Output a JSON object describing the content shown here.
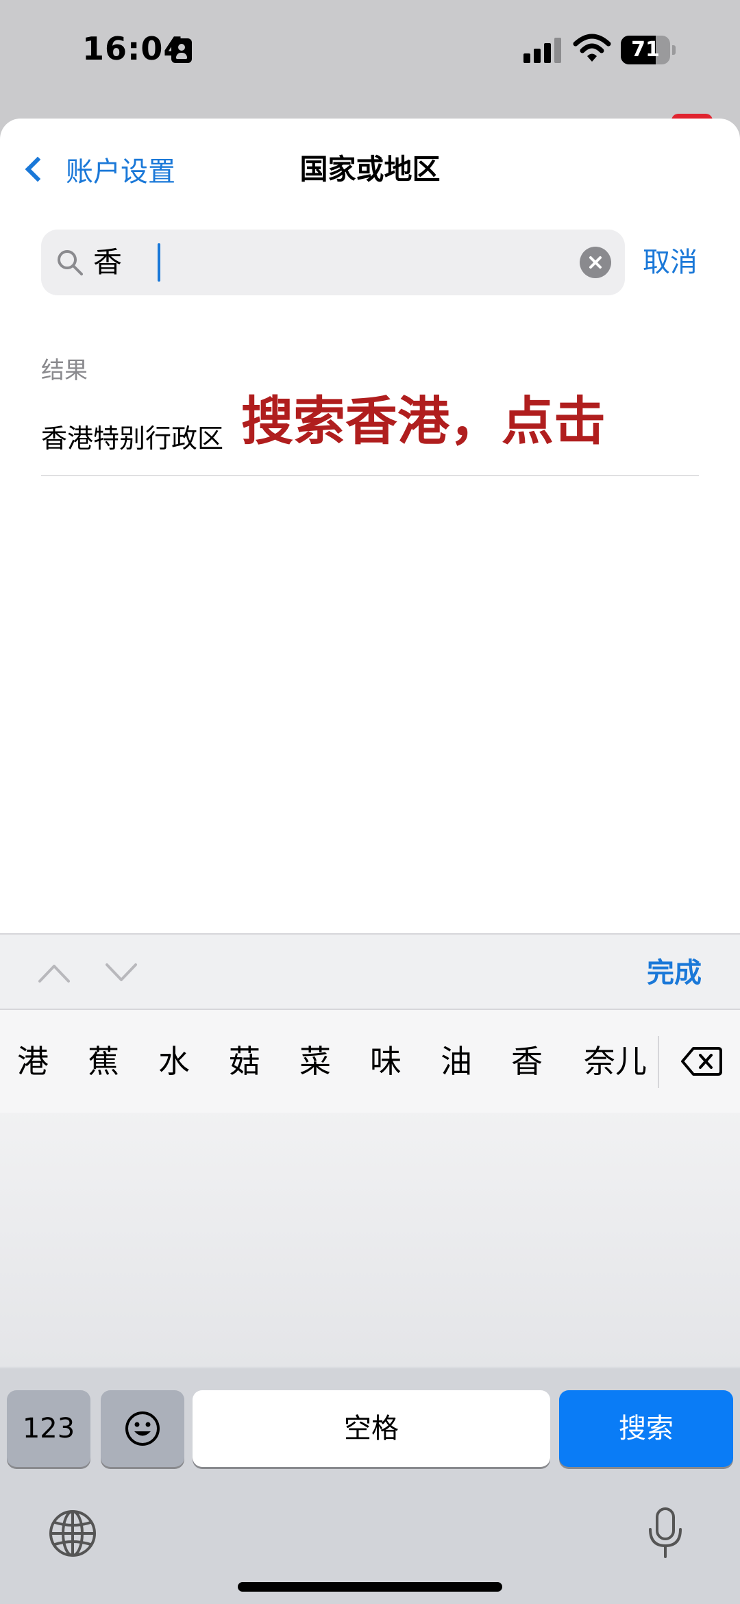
{
  "status_bar": {
    "time": "16:04",
    "battery": "71",
    "battery_level": 0.71
  },
  "nav": {
    "back_label": "账户设置",
    "title": "国家或地区"
  },
  "search": {
    "value": "香",
    "cancel_label": "取消"
  },
  "results": {
    "header": "结果",
    "items": [
      "香港特别行政区"
    ]
  },
  "annotation": "搜索香港，点击",
  "accessory": {
    "done_label": "完成"
  },
  "keyboard": {
    "candidates": [
      "港",
      "蕉",
      "水",
      "菇",
      "菜",
      "味",
      "油",
      "香",
      "奈儿"
    ],
    "numbers_label": "123",
    "space_label": "空格",
    "search_label": "搜索"
  },
  "colors": {
    "accent": "#1a78d8",
    "annotation": "#b01e1e",
    "search_key": "#0a7cf6"
  },
  "icons": [
    "id-card-icon",
    "signal-icon",
    "wifi-icon",
    "battery-icon",
    "back-chevron-icon",
    "search-icon",
    "clear-icon",
    "chevron-up-icon",
    "chevron-down-icon",
    "backspace-icon",
    "emoji-icon",
    "globe-icon",
    "mic-icon"
  ]
}
